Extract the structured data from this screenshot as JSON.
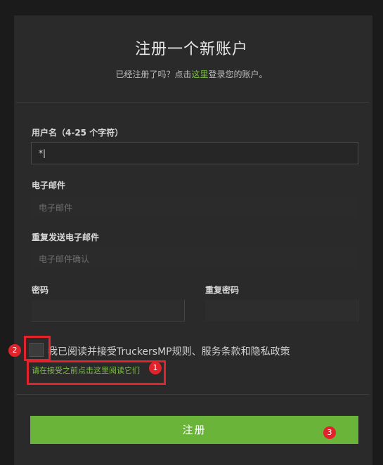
{
  "header": {
    "title": "注册一个新账户",
    "subtitle_before": "已经注册了吗？点击",
    "subtitle_link": "这里",
    "subtitle_after": "登录您的账户。"
  },
  "form": {
    "username_label": "用户名（4-25 个字符）",
    "username_value": "*|",
    "email_label": "电子邮件",
    "email_placeholder": "电子邮件",
    "email_confirm_label": "重复发送电子邮件",
    "email_confirm_placeholder": "电子邮件确认",
    "password_label": "密码",
    "password_confirm_label": "重复密码",
    "terms_label": "我已阅读并接受TruckersMP规则、服务条款和隐私政策",
    "read_terms_link": "请在接受之前点击这里阅读它们",
    "submit_label": "注册"
  },
  "annotations": {
    "badge_1": "1",
    "badge_2": "2",
    "badge_3": "3",
    "highlight_color": "#e3232b"
  },
  "colors": {
    "accent": "#6ab43a",
    "link": "#7cc242",
    "background": "#2a2a2a"
  }
}
